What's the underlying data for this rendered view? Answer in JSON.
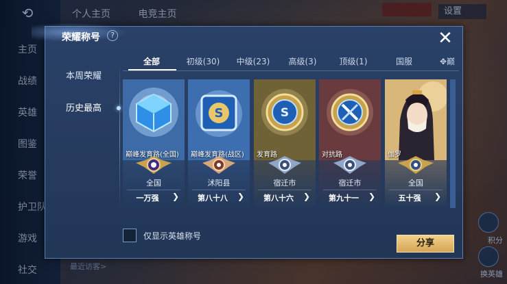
{
  "background": {
    "nav_items": [
      "主页",
      "战绩",
      "英雄",
      "图鉴",
      "荣誉",
      "护卫队",
      "游戏",
      "社交"
    ],
    "top_tabs": [
      "个人主页",
      "电竞主页"
    ],
    "settings_label": "设置",
    "bottom_hint": "最近访客>",
    "right_labels": [
      "积分",
      "换英雄"
    ]
  },
  "modal": {
    "title": "荣耀称号",
    "help_label": "?",
    "close_label": "✕",
    "side_menu": [
      {
        "label": "本周荣耀",
        "active": false
      },
      {
        "label": "历史最高",
        "active": true
      }
    ],
    "tabs": [
      {
        "label": "全部",
        "active": true
      },
      {
        "label": "初级(30)",
        "active": false
      },
      {
        "label": "中级(23)",
        "active": false
      },
      {
        "label": "高级(3)",
        "active": false
      },
      {
        "label": "顶级(1)",
        "active": false
      },
      {
        "label": "国服",
        "active": false
      },
      {
        "label": "✥巅",
        "active": false
      }
    ],
    "cards": [
      {
        "name": "巅峰发育路(全国)",
        "region": "全国",
        "rank": "一万强",
        "art": "blue-cube"
      },
      {
        "name": "巅峰发育路(战区)",
        "region": "沭阳县",
        "rank": "第八十八",
        "art": "s-shield"
      },
      {
        "name": "发育路",
        "region": "宿迁市",
        "rank": "第八十六",
        "art": "gold-s-emblem"
      },
      {
        "name": "对抗路",
        "region": "宿迁市",
        "rank": "第九十一",
        "art": "gold-sword-emblem"
      },
      {
        "name": "伽罗",
        "region": "全国",
        "rank": "五十强",
        "art": "hero-portrait"
      }
    ],
    "checkbox_label": "仅显示英雄称号",
    "share_label": "分享"
  },
  "colors": {
    "modal_bg": "#2a4168",
    "accent_gold": "#d5a656",
    "text_primary": "#ffffff"
  }
}
